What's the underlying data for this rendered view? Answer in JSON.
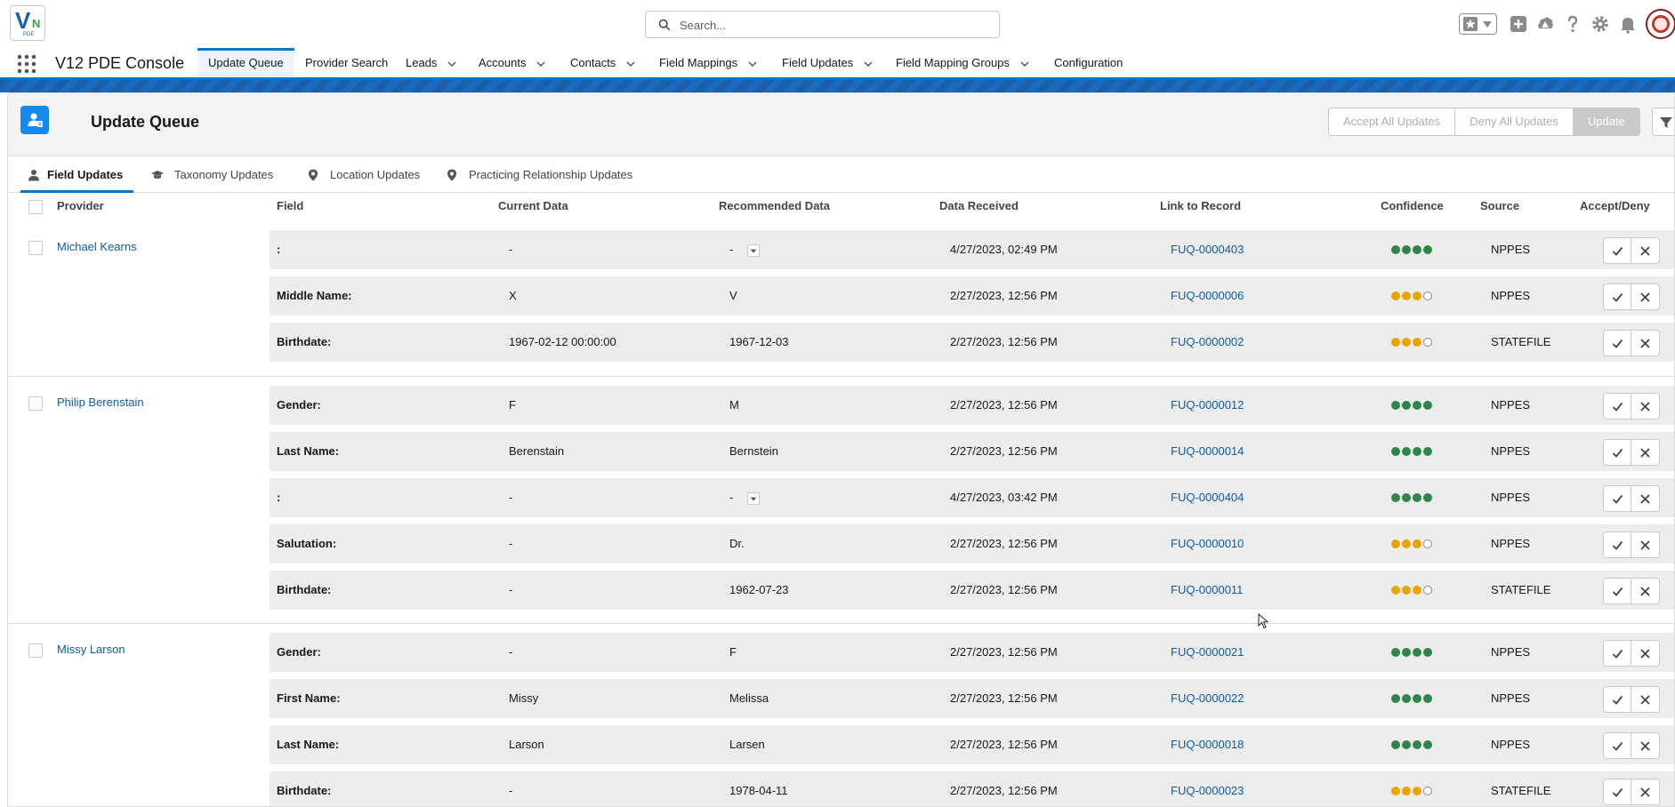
{
  "header": {
    "logo": {
      "letters": "V",
      "mark": "N",
      "sub": "PDE"
    },
    "search_placeholder": "Search...",
    "icons": [
      "favorites-star-icon",
      "favorites-dropdown-icon",
      "add-icon",
      "trailhead-icon",
      "help-icon",
      "setup-gear-icon",
      "notifications-bell-icon",
      "user-avatar"
    ]
  },
  "nav": {
    "app_name": "V12 PDE Console",
    "items": [
      {
        "label": "Update Queue",
        "active": true,
        "dropdown": false
      },
      {
        "label": "Provider Search",
        "dropdown": false
      },
      {
        "label": "Leads",
        "dropdown": true
      },
      {
        "label": "Accounts",
        "dropdown": true
      },
      {
        "label": "Contacts",
        "dropdown": true
      },
      {
        "label": "Field Mappings",
        "dropdown": true
      },
      {
        "label": "Field Updates",
        "dropdown": true
      },
      {
        "label": "Field Mapping Groups",
        "dropdown": true
      },
      {
        "label": "Configuration",
        "dropdown": false
      }
    ]
  },
  "card": {
    "title": "Update Queue",
    "buttons": {
      "accept_all": "Accept All Updates",
      "deny_all": "Deny All Updates",
      "update": "Update"
    }
  },
  "tabs": [
    {
      "label": "Field Updates",
      "icon": "user-icon",
      "active": true
    },
    {
      "label": "Taxonomy Updates",
      "icon": "graduation-cap-icon"
    },
    {
      "label": "Location Updates",
      "icon": "location-pin-icon"
    },
    {
      "label": "Practicing Relationship Updates",
      "icon": "location-pin-icon"
    }
  ],
  "columns": {
    "provider": "Provider",
    "field": "Field",
    "current": "Current Data",
    "recommended": "Recommended Data",
    "received": "Data Received",
    "link": "Link to Record",
    "confidence": "Confidence",
    "source": "Source",
    "accept_deny": "Accept/Deny"
  },
  "colors": {
    "accent": "#0176d3",
    "link": "#0b5cab",
    "confidence_high": "#2e844a",
    "confidence_mid": "#e8a400"
  },
  "groups": [
    {
      "provider": "Michael Kearns",
      "rows": [
        {
          "field": ":",
          "current": "-",
          "recommended": "-",
          "dropdown": true,
          "received": "4/27/2023, 02:49 PM",
          "link": "FUQ-0000403",
          "confidence": 4,
          "level": "green",
          "source": "NPPES"
        },
        {
          "field": "Middle Name:",
          "current": "X",
          "recommended": "V",
          "received": "2/27/2023, 12:56 PM",
          "link": "FUQ-0000006",
          "confidence": 3,
          "level": "yellow",
          "source": "NPPES"
        },
        {
          "field": "Birthdate:",
          "current": "1967-02-12 00:00:00",
          "recommended": "1967-12-03",
          "received": "2/27/2023, 12:56 PM",
          "link": "FUQ-0000002",
          "confidence": 3,
          "level": "yellow",
          "source": "STATEFILE"
        }
      ]
    },
    {
      "provider": "Philip Berenstain",
      "rows": [
        {
          "field": "Gender:",
          "current": "F",
          "recommended": "M",
          "received": "2/27/2023, 12:56 PM",
          "link": "FUQ-0000012",
          "confidence": 4,
          "level": "green",
          "source": "NPPES"
        },
        {
          "field": "Last Name:",
          "current": "Berenstain",
          "recommended": "Bernstein",
          "received": "2/27/2023, 12:56 PM",
          "link": "FUQ-0000014",
          "confidence": 4,
          "level": "green",
          "source": "NPPES"
        },
        {
          "field": ":",
          "current": "-",
          "recommended": "-",
          "dropdown": true,
          "received": "4/27/2023, 03:42 PM",
          "link": "FUQ-0000404",
          "confidence": 4,
          "level": "green",
          "source": "NPPES"
        },
        {
          "field": "Salutation:",
          "current": "-",
          "recommended": "Dr.",
          "received": "2/27/2023, 12:56 PM",
          "link": "FUQ-0000010",
          "confidence": 3,
          "level": "yellow",
          "source": "NPPES"
        },
        {
          "field": "Birthdate:",
          "current": "-",
          "recommended": "1962-07-23",
          "received": "2/27/2023, 12:56 PM",
          "link": "FUQ-0000011",
          "confidence": 3,
          "level": "yellow",
          "source": "STATEFILE"
        }
      ]
    },
    {
      "provider": "Missy Larson",
      "rows": [
        {
          "field": "Gender:",
          "current": "-",
          "recommended": "F",
          "received": "2/27/2023, 12:56 PM",
          "link": "FUQ-0000021",
          "confidence": 4,
          "level": "green",
          "source": "NPPES"
        },
        {
          "field": "First Name:",
          "current": "Missy",
          "recommended": "Melissa",
          "received": "2/27/2023, 12:56 PM",
          "link": "FUQ-0000022",
          "confidence": 4,
          "level": "green",
          "source": "NPPES"
        },
        {
          "field": "Last Name:",
          "current": "Larson",
          "recommended": "Larsen",
          "received": "2/27/2023, 12:56 PM",
          "link": "FUQ-0000018",
          "confidence": 4,
          "level": "green",
          "source": "NPPES"
        },
        {
          "field": "Birthdate:",
          "current": "-",
          "recommended": "1978-04-11",
          "received": "2/27/2023, 12:56 PM",
          "link": "FUQ-0000023",
          "confidence": 3,
          "level": "yellow",
          "source": "STATEFILE"
        }
      ]
    }
  ]
}
